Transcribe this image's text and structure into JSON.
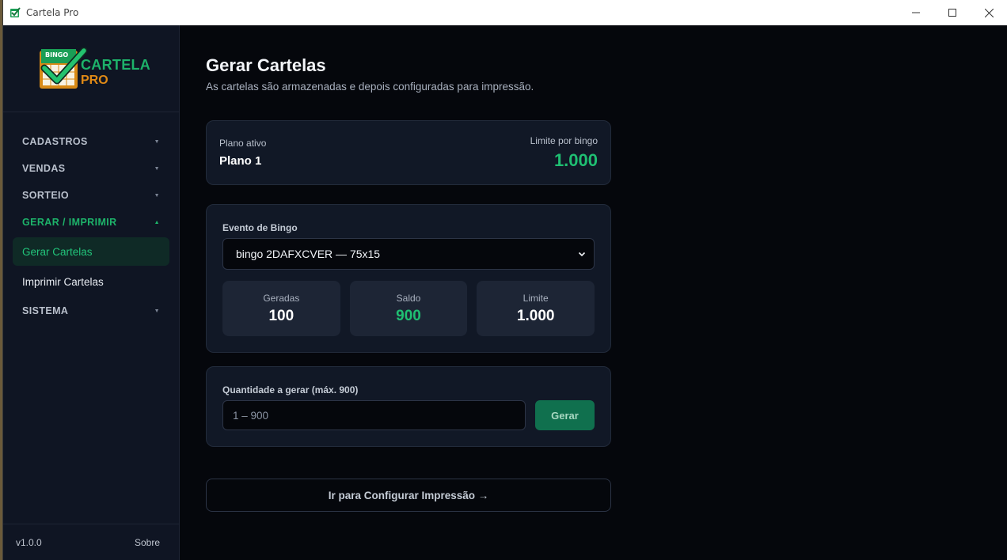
{
  "window": {
    "title": "Cartela Pro"
  },
  "sidebar": {
    "logo": {
      "badge": "BINGO",
      "line1": "CARTELA",
      "line2": "PRO"
    },
    "sections": [
      {
        "label": "CADASTROS"
      },
      {
        "label": "VENDAS"
      },
      {
        "label": "SORTEIO"
      },
      {
        "label": "GERAR / IMPRIMIR"
      }
    ],
    "items": [
      {
        "label": "Gerar Cartelas"
      },
      {
        "label": "Imprimir Cartelas"
      }
    ],
    "system_label": "SISTEMA",
    "version": "v1.0.0",
    "about": "Sobre"
  },
  "main": {
    "title": "Gerar Cartelas",
    "subtitle": "As cartelas são armazenadas e depois configuradas para impressão.",
    "plan": {
      "label": "Plano ativo",
      "name": "Plano 1",
      "limit_label": "Limite por bingo",
      "limit_value": "1.000"
    },
    "event": {
      "label": "Evento de Bingo",
      "selected": "bingo 2DAFXCVER — 75x15",
      "stats": [
        {
          "label": "Geradas",
          "value": "100"
        },
        {
          "label": "Saldo",
          "value": "900"
        },
        {
          "label": "Limite",
          "value": "1.000"
        }
      ]
    },
    "quantity": {
      "label": "Quantidade a gerar  (máx. 900)",
      "placeholder": "1 – 900",
      "button": "Gerar"
    },
    "config_button": "Ir para Configurar Impressão →"
  },
  "colors": {
    "accent": "#1fbf72",
    "accent_dark": "#10704e",
    "brand_orange": "#e08a16",
    "background": "#05070c",
    "card": "#111826"
  }
}
